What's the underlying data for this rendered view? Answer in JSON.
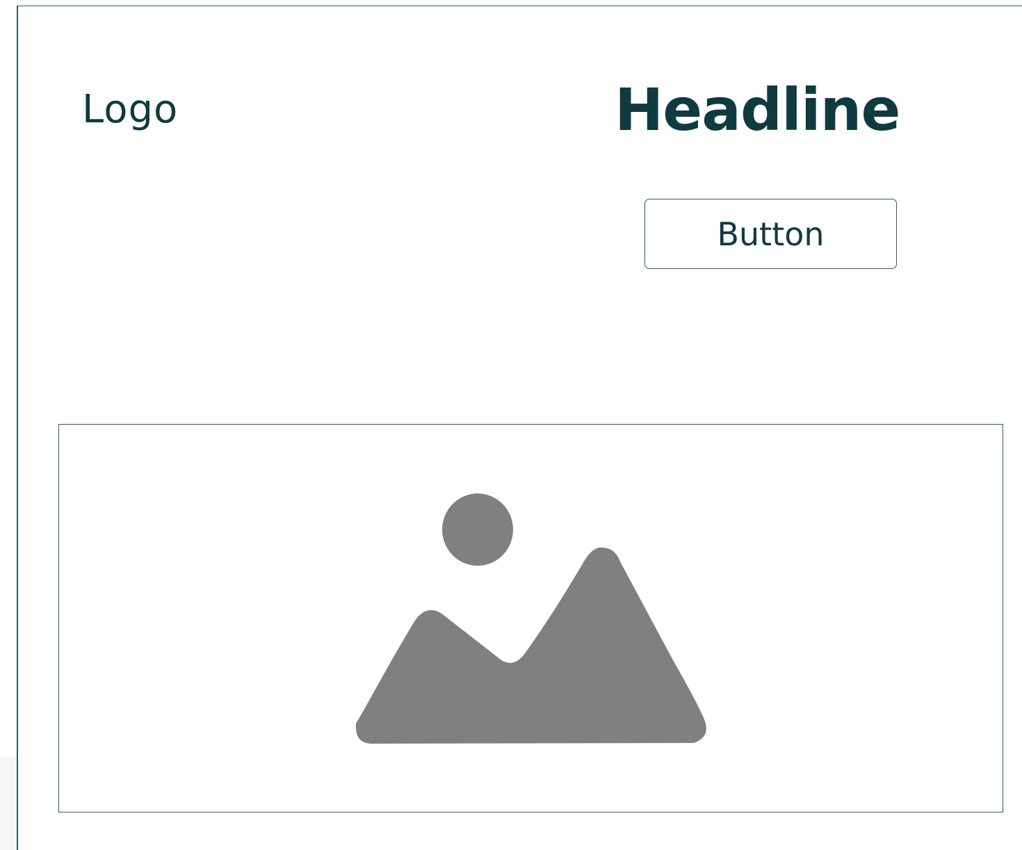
{
  "header": {
    "logo_text": "Logo",
    "headline": "Headline"
  },
  "cta": {
    "button_label": "Button"
  },
  "media": {
    "icon": "image-placeholder-icon"
  },
  "colors": {
    "text": "#0f3a40",
    "border": "#2f5a60",
    "icon_fill": "#808082",
    "background": "#ffffff"
  }
}
